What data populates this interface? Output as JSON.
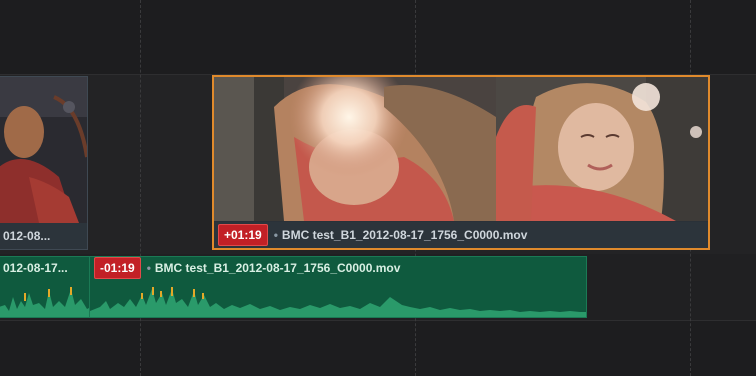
{
  "timeline": {
    "clips": {
      "left_video": {
        "label": "012-08..."
      },
      "selected_video": {
        "timecode": "+01:19",
        "filename": "BMC test_B1_2012-08-17_1756_C0000.mov"
      },
      "left_audio": {
        "label": "012-08-17..."
      },
      "audio": {
        "timecode": "-01:19",
        "filename": "BMC test_B1_2012-08-17_1756_C0000.mov"
      }
    }
  },
  "colors": {
    "selection_border": "#e08a2c",
    "timecode_badge": "#c22026",
    "audio_clip": "#0f5a3e",
    "video_clip_footer": "#2c343b"
  }
}
